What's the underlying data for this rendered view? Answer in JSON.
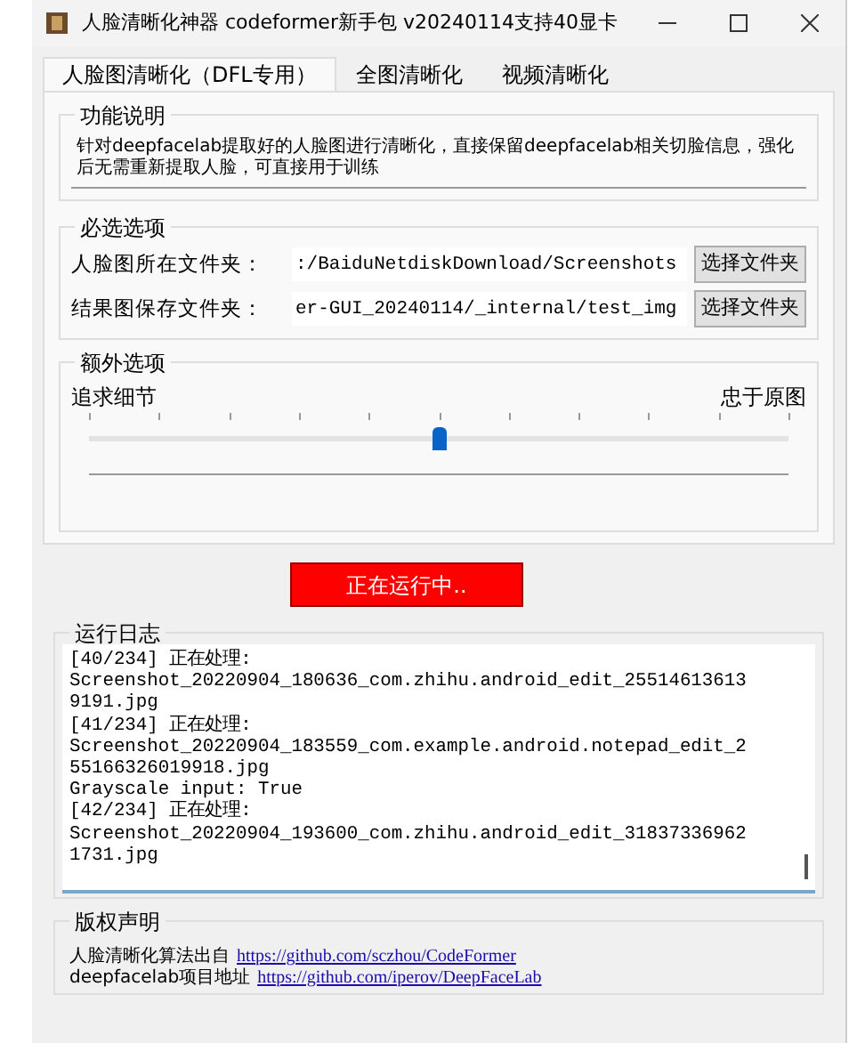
{
  "window": {
    "title": "人脸清晰化神器 codeformer新手包 v20240114支持40显卡"
  },
  "tabs": [
    {
      "label": "人脸图清晰化（DFL专用）",
      "selected": true
    },
    {
      "label": "全图清晰化",
      "selected": false
    },
    {
      "label": "视频清晰化",
      "selected": false
    }
  ],
  "description": {
    "title": "功能说明",
    "text": "针对deepfacelab提取好的人脸图进行清晰化，直接保留deepfacelab相关切脸信息，强化后无需重新提取人脸，可直接用于训练"
  },
  "required": {
    "title": "必选选项",
    "rows": [
      {
        "label": "人脸图所在文件夹：",
        "value": ":/BaiduNetdiskDownload/Screenshots",
        "button": "选择文件夹"
      },
      {
        "label": "结果图保存文件夹：",
        "value": "er-GUI_20240114/_internal/test_img",
        "button": "选择文件夹"
      }
    ]
  },
  "extra": {
    "title": "额外选项",
    "left_label": "追求细节",
    "right_label": "忠于原图",
    "slider": {
      "level": 0.5
    }
  },
  "run_button": "正在运行中..",
  "log": {
    "title": "运行日志",
    "lines": [
      "[40/234] 正在处理:",
      "Screenshot_20220904_180636_com.zhihu.android_edit_25514613613",
      "9191.jpg",
      "[41/234] 正在处理:",
      "Screenshot_20220904_183559_com.example.android.notepad_edit_2",
      "55166326019918.jpg",
      "Grayscale input: True",
      "[42/234] 正在处理:",
      "Screenshot_20220904_193600_com.zhihu.android_edit_31837336962",
      "1731.jpg"
    ]
  },
  "copyright": {
    "title": "版权声明",
    "lines": [
      {
        "text": "人脸清晰化算法出自",
        "link": "https://github.com/sczhou/CodeFormer"
      },
      {
        "text": "deepfacelab项目地址",
        "link": "https://github.com/iperov/DeepFaceLab"
      }
    ]
  }
}
